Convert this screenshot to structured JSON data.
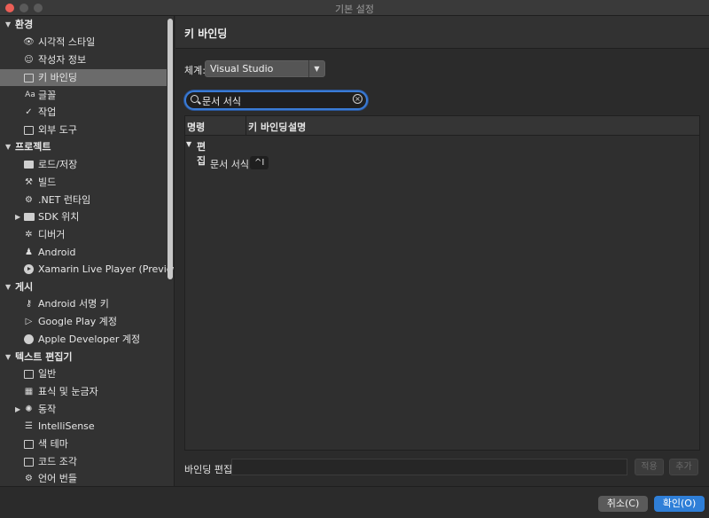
{
  "window": {
    "title": "기본 설정"
  },
  "sidebar": {
    "categories": [
      {
        "label": "환경",
        "items": [
          {
            "label": "시각적 스타일",
            "icon": "eye-icon"
          },
          {
            "label": "작성자 정보",
            "icon": "smiley-icon"
          },
          {
            "label": "키 바인딩",
            "icon": "keyboard-icon",
            "selected": true
          },
          {
            "label": "글꼴",
            "icon": "font-icon"
          },
          {
            "label": "작업",
            "icon": "check-icon"
          },
          {
            "label": "외부 도구",
            "icon": "terminal-icon"
          }
        ]
      },
      {
        "label": "프로젝트",
        "items": [
          {
            "label": "로드/저장",
            "icon": "drive-icon"
          },
          {
            "label": "빌드",
            "icon": "hammer-icon"
          },
          {
            "label": ".NET 런타임",
            "icon": "gear-icon"
          },
          {
            "label": "SDK 위치",
            "icon": "folder-icon"
          },
          {
            "label": "디버거",
            "icon": "bug-icon"
          },
          {
            "label": "Android",
            "icon": "android-icon"
          },
          {
            "label": "Xamarin Live Player (Preview)",
            "icon": "play-icon"
          }
        ]
      },
      {
        "label": "게시",
        "items": [
          {
            "label": "Android 서명 키",
            "icon": "key-icon"
          },
          {
            "label": "Google Play 계정",
            "icon": "google-play-icon"
          },
          {
            "label": "Apple Developer 계정",
            "icon": "apple-icon"
          }
        ]
      },
      {
        "label": "텍스트 편집기",
        "items": [
          {
            "label": "일반",
            "icon": "edit-icon"
          },
          {
            "label": "표식 및 눈금자",
            "icon": "grid-icon"
          },
          {
            "label": "동작",
            "icon": "behavior-icon"
          },
          {
            "label": "IntelliSense",
            "icon": "list-icon"
          },
          {
            "label": "색 테마",
            "icon": "palette-icon"
          },
          {
            "label": "코드 조각",
            "icon": "snippet-icon"
          },
          {
            "label": "언어 번들",
            "icon": "gear-icon"
          }
        ]
      }
    ]
  },
  "main": {
    "title": "키 바인딩",
    "scheme_label": "체계:",
    "scheme_value": "Visual Studio",
    "search_value": "문서 서식",
    "table": {
      "headers": [
        "명령",
        "키 바인딩",
        "설명"
      ],
      "group": "편집",
      "row": {
        "command": "문서 서식",
        "binding": "^I"
      }
    },
    "binding_label": "바인딩 편집",
    "apply_button": "적용",
    "add_button": "추가"
  },
  "footer": {
    "cancel_button": "취소(C)",
    "ok_button": "확인(O)"
  },
  "colors": {
    "accent": "#2f7fd8",
    "selected_row": "#6b6b6b"
  }
}
